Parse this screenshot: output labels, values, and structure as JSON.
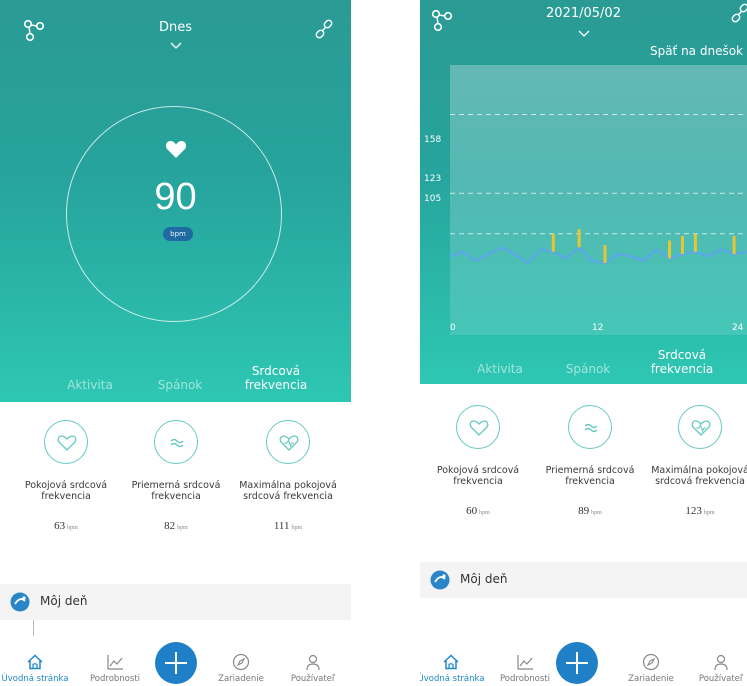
{
  "left": {
    "header": {
      "date_label": "Dnes"
    },
    "heart_rate": {
      "value": "90",
      "unit": "bpm"
    },
    "tabs": [
      {
        "label": "Aktivita",
        "active": false
      },
      {
        "label": "Spánok",
        "active": false
      },
      {
        "label": "Srdcová frekvencia",
        "active": true
      }
    ],
    "metrics": [
      {
        "label": "Pokojová srdcová frekvencia",
        "value": "63",
        "unit": "bpm",
        "icon": "heart-icon"
      },
      {
        "label": "Priemerná srdcová frekvencia",
        "value": "82",
        "unit": "bpm",
        "icon": "wave-icon"
      },
      {
        "label": "Maximálna pokojová srdcová frekvencia",
        "value": "111",
        "unit": "bpm",
        "icon": "heart-pulse-icon"
      }
    ],
    "my_day": {
      "label": "Môj deň"
    }
  },
  "right": {
    "header": {
      "date_label": "2021/05/02",
      "back_today": "Späť na dnešok"
    },
    "chart_data": {
      "type": "line",
      "x_ticks": [
        "0",
        "12",
        "24"
      ],
      "y_ticks": [
        "158",
        "123",
        "105"
      ],
      "xlim": [
        0,
        24
      ],
      "ylim": [
        60,
        180
      ],
      "series": [
        {
          "values": [
            95,
            97,
            93,
            96,
            99,
            96,
            92,
            98,
            97,
            94,
            99,
            93,
            92,
            96,
            95,
            93,
            98,
            94,
            96,
            97,
            95,
            98,
            96,
            97
          ]
        }
      ]
    },
    "tabs": [
      {
        "label": "Aktivita",
        "active": false
      },
      {
        "label": "Spánok",
        "active": false
      },
      {
        "label": "Srdcová frekvencia",
        "active": true
      }
    ],
    "metrics": [
      {
        "label": "Pokojová srdcová frekvencia",
        "value": "60",
        "unit": "bpm",
        "icon": "heart-icon"
      },
      {
        "label": "Priemerná srdcová frekvencia",
        "value": "89",
        "unit": "bpm",
        "icon": "wave-icon"
      },
      {
        "label": "Maximálna pokojová srdcová frekvencia",
        "value": "123",
        "unit": "bpm",
        "icon": "heart-pulse-icon"
      }
    ],
    "my_day": {
      "label": "Môj deň"
    }
  },
  "nav": [
    {
      "label": "Úvodná stránka",
      "icon": "home-icon",
      "active": true
    },
    {
      "label": "Podrobnosti",
      "icon": "chart-icon",
      "active": false
    },
    {
      "label": "Zariadenie",
      "icon": "compass-icon",
      "active": false
    },
    {
      "label": "Používateľ",
      "icon": "user-icon",
      "active": false
    }
  ],
  "colors": {
    "teal_top": "#2a9a94",
    "teal_bottom": "#2ec7b3",
    "accent_blue": "#1f7fc7",
    "bar_yellow": "#e8c531"
  }
}
